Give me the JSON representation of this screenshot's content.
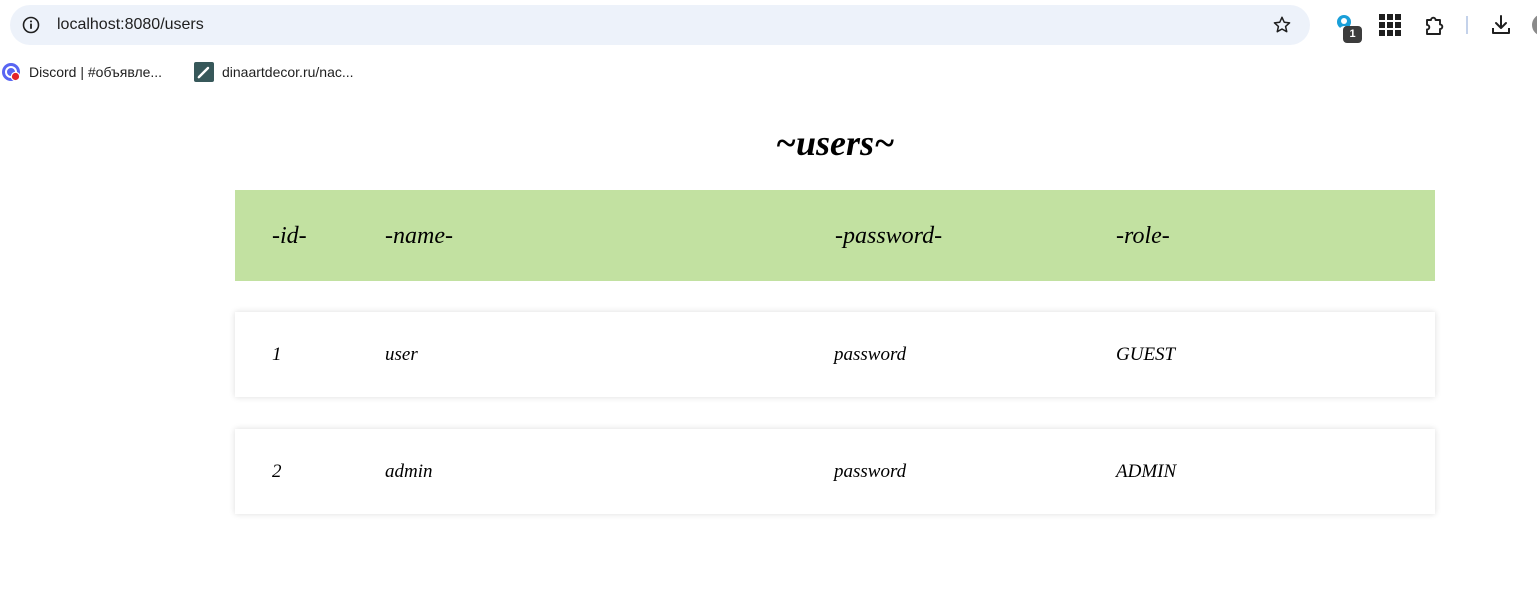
{
  "browser": {
    "url": "localhost:8080/users",
    "extension_badge": "1"
  },
  "bookmarks": [
    {
      "label": "Discord | #объявле...",
      "icon": "discord-favicon"
    },
    {
      "label": "dinaartdecor.ru/nac...",
      "icon": "pencil-favicon"
    }
  ],
  "page": {
    "title": "~users~"
  },
  "table": {
    "headers": {
      "id": "-id-",
      "name": "-name-",
      "password": "-password-",
      "role": "-role-"
    },
    "rows": [
      {
        "id": "1",
        "name": "user",
        "password": "password",
        "role": "GUEST"
      },
      {
        "id": "2",
        "name": "admin",
        "password": "password",
        "role": "ADMIN"
      }
    ]
  },
  "colors": {
    "header_background": "#c2e1a1",
    "omnibox_background": "#edf2fa"
  }
}
